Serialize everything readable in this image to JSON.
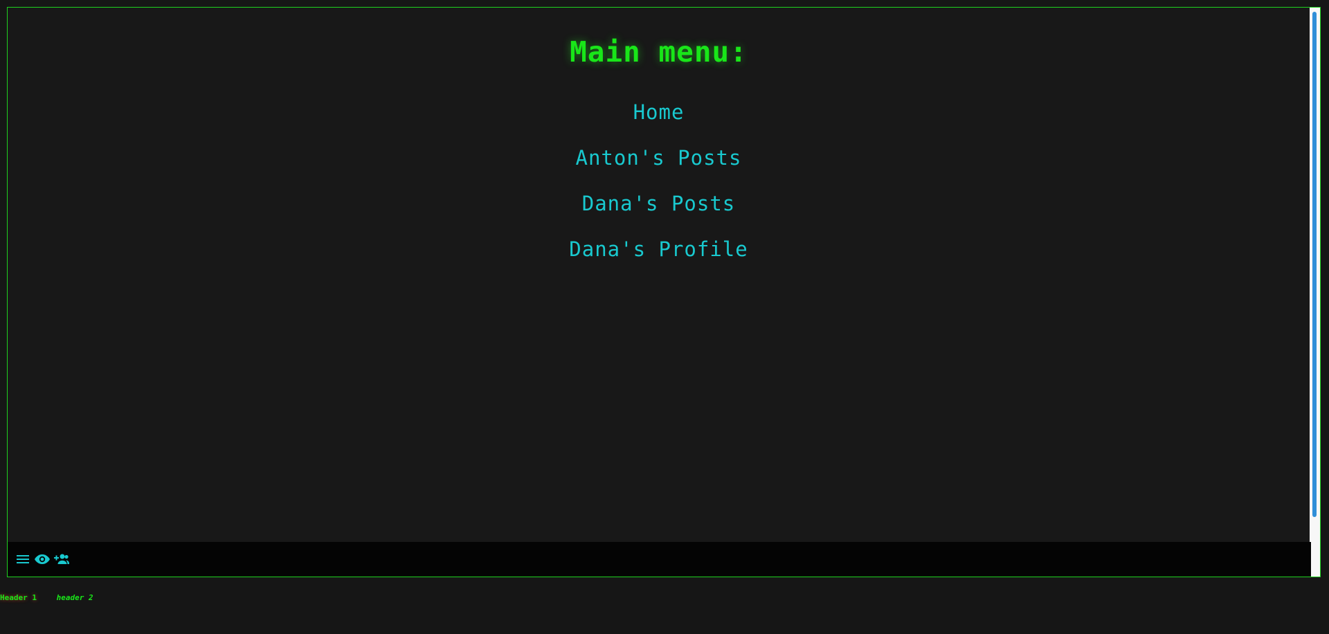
{
  "main": {
    "title": "Main menu:",
    "menu_items": [
      {
        "label": "Home"
      },
      {
        "label": "Anton's Posts"
      },
      {
        "label": "Dana's Posts"
      },
      {
        "label": "Dana's Profile"
      }
    ]
  },
  "toolbar": {
    "buttons": [
      {
        "icon": "menu-icon"
      },
      {
        "icon": "eye-icon"
      },
      {
        "icon": "add-user-icon"
      }
    ]
  },
  "footer": {
    "header1": "Header 1",
    "header2": "header 2"
  },
  "colors": {
    "title": "#19e619",
    "link": "#19c9cf",
    "border": "#1fd21f",
    "background": "#181818",
    "scroll_thumb": "#2f8fd8"
  }
}
